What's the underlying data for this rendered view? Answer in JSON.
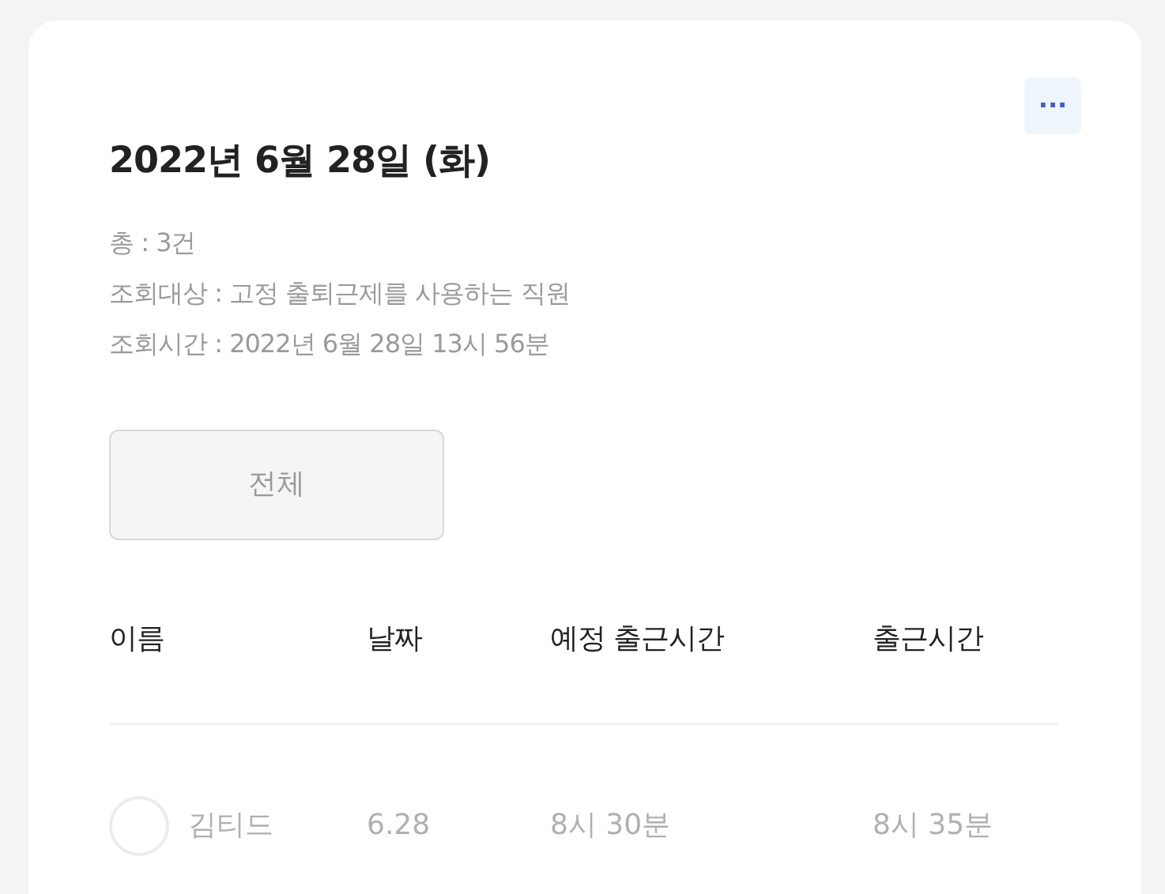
{
  "card": {
    "title": "2022년 6월 28일 (화)",
    "more_button": "···",
    "info": [
      "총 : 3건",
      "조회대상 : 고정 출퇴근제를 사용하는 직원",
      "조회시간 : 2022년 6월 28일 13시 56분"
    ],
    "filter_button": "전체",
    "table": {
      "columns": [
        "이름",
        "날짜",
        "예정 출근시간",
        "출근시간"
      ],
      "rows": [
        {
          "checked": false,
          "cells": [
            "김티드",
            "6.28",
            "8시 30분",
            "8시 35분"
          ]
        }
      ]
    }
  }
}
